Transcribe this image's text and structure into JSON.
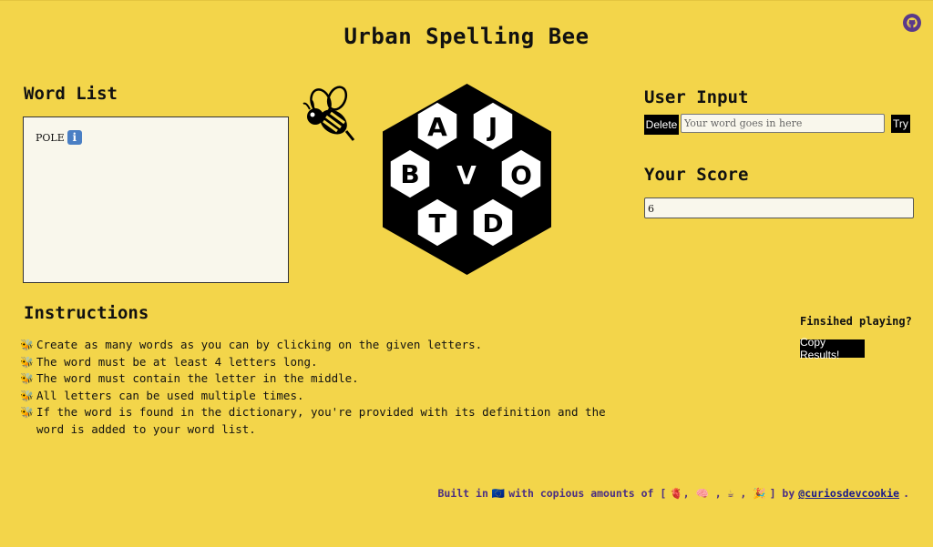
{
  "header": {
    "title": "Urban Spelling Bee",
    "github_icon": "github-icon"
  },
  "word_list": {
    "title": "Word List",
    "words": [
      {
        "text": "POLE",
        "icon": "info-icon",
        "icon_glyph": "i"
      }
    ]
  },
  "hive": {
    "letters": [
      "A",
      "J",
      "B",
      "V",
      "O",
      "T",
      "D"
    ],
    "center_letter": "V",
    "colors": {
      "outer": "#000000",
      "cell": "#ffffff",
      "center": "#000000"
    }
  },
  "user_input": {
    "title": "User Input",
    "delete_label": "Delete",
    "placeholder": "Your word goes in here",
    "try_label": "Try"
  },
  "score": {
    "title": "Your Score",
    "value": "6"
  },
  "instructions": {
    "title": "Instructions",
    "bullet_icon": "bee-icon",
    "items": [
      "Create as many words as you can by clicking on the given letters.",
      "The word must be at least 4 letters long.",
      "The word must contain the letter in the middle.",
      "All letters can be used multiple times.",
      "If the word is found in the dictionary, you're provided with its definition and the word is added to your word list."
    ]
  },
  "finish": {
    "prompt": "Finsihed playing?",
    "copy_label": "Copy Results!"
  },
  "footer": {
    "built_in": "Built in",
    "flag": "🇪🇺",
    "with_text": "with copious amounts of [",
    "items": "🫀, 🧠 , ☕ , 🎉",
    "close": "] by",
    "author": "@curiosdevcookie",
    "end": "."
  },
  "colors": {
    "background": "#f3d54a",
    "button": "#000000",
    "footer_text": "#4b2f84"
  }
}
